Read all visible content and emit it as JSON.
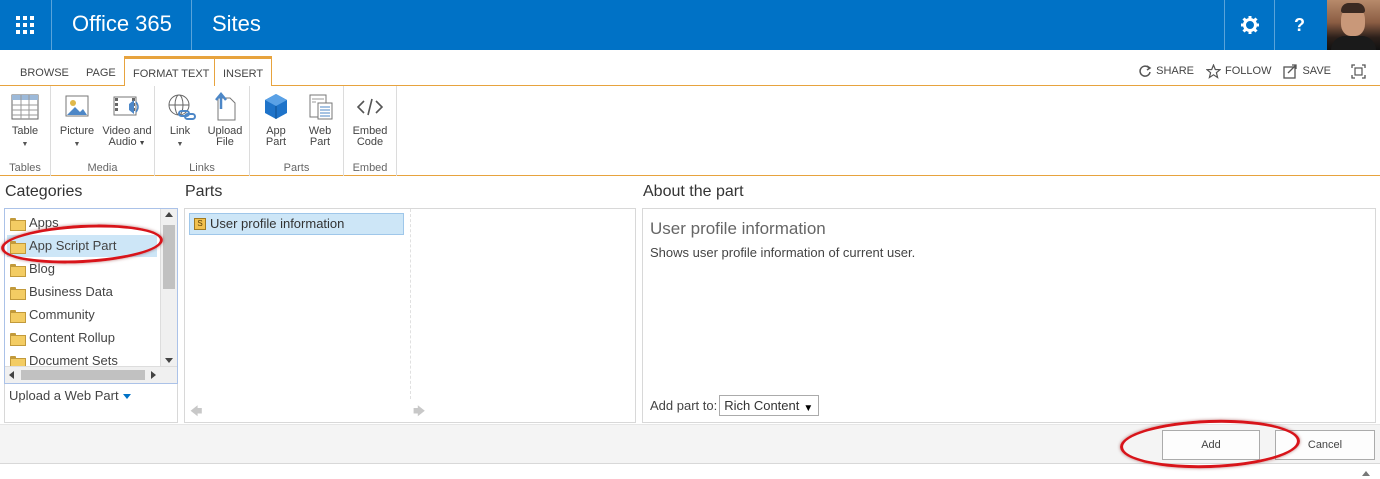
{
  "suitebar": {
    "brand": "Office 365",
    "site_title": "Sites",
    "settings_icon": "gear-icon",
    "help_label": "?"
  },
  "ribbon_tabs": [
    "BROWSE",
    "PAGE",
    "FORMAT TEXT",
    "INSERT"
  ],
  "active_tab": "INSERT",
  "top_actions": {
    "share": "SHARE",
    "follow": "FOLLOW",
    "save": "SAVE"
  },
  "ribbon_groups": [
    {
      "label": "Tables",
      "buttons": [
        {
          "label_1": "Table",
          "label_2": "",
          "icon": "table-icon"
        }
      ]
    },
    {
      "label": "Media",
      "buttons": [
        {
          "label_1": "Picture",
          "label_2": "",
          "icon": "picture-icon"
        },
        {
          "label_1": "Video and",
          "label_2": "Audio",
          "icon": "video-audio-icon"
        }
      ]
    },
    {
      "label": "Links",
      "buttons": [
        {
          "label_1": "Link",
          "label_2": "",
          "icon": "link-icon"
        },
        {
          "label_1": "Upload",
          "label_2": "File",
          "icon": "upload-file-icon"
        }
      ]
    },
    {
      "label": "Parts",
      "buttons": [
        {
          "label_1": "App",
          "label_2": "Part",
          "icon": "app-part-icon"
        },
        {
          "label_1": "Web",
          "label_2": "Part",
          "icon": "web-part-icon"
        }
      ]
    },
    {
      "label": "Embed",
      "buttons": [
        {
          "label_1": "Embed",
          "label_2": "Code",
          "icon": "embed-code-icon"
        }
      ]
    }
  ],
  "categories": {
    "heading": "Categories",
    "items": [
      "Apps",
      "App Script Part",
      "Blog",
      "Business Data",
      "Community",
      "Content Rollup",
      "Document Sets"
    ],
    "selected": "App Script Part",
    "upload_label": "Upload a Web Part"
  },
  "parts": {
    "heading": "Parts",
    "items": [
      "User profile information"
    ],
    "selected": "User profile information"
  },
  "about": {
    "heading": "About the part",
    "title": "User profile information",
    "description": "Shows user profile information of current user.",
    "add_to_label": "Add part to:",
    "add_to_value": "Rich Content"
  },
  "buttons": {
    "add": "Add",
    "cancel": "Cancel"
  },
  "colors": {
    "suitebar": "#0072c6",
    "accent_orange": "#e7a33e",
    "selection": "#cde6f7",
    "annotation_red": "#d8141a"
  }
}
